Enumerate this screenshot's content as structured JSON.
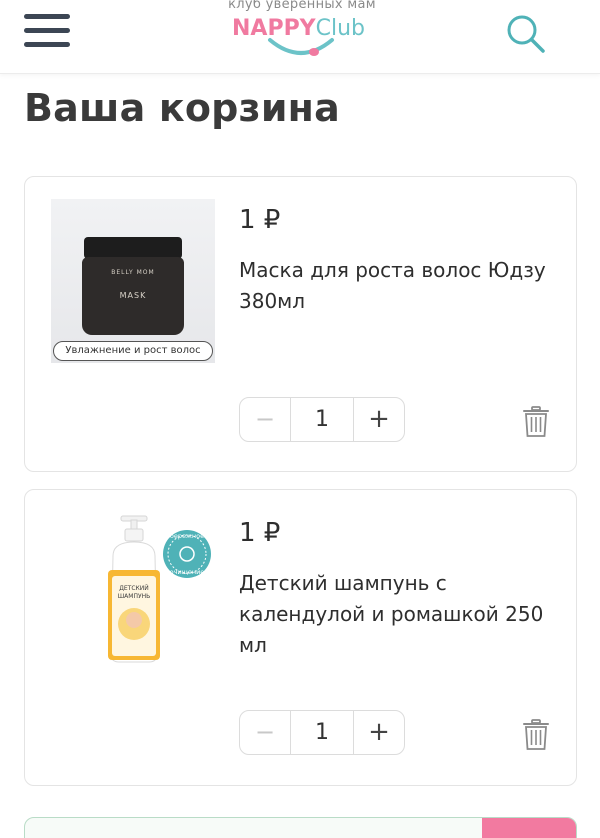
{
  "header": {
    "tagline": "клуб уверенных мам",
    "brand_part1": "NAPPY",
    "brand_part2": "Club",
    "brand_color_pink": "#f07aa0",
    "brand_color_teal": "#6cc3c8",
    "menu_icon": "hamburger-menu-icon",
    "search_icon": "search-icon"
  },
  "page": {
    "title": "Ваша корзина"
  },
  "cart": {
    "items": [
      {
        "price": "1 ₽",
        "name": "Маска для роста волос Юдзу 380мл",
        "image_badge": "Увлажнение и рост волос",
        "jar_brand": "BELLY MOM",
        "jar_label": "MASK",
        "quantity": "1",
        "minus_label": "−",
        "plus_label": "+",
        "delete_icon": "trash-icon"
      },
      {
        "price": "1 ₽",
        "name": "Детский шампунь с календулой и ромашкой 250 мл",
        "sticker_line1": "бережное",
        "sticker_line2": "очищение",
        "bottle_label_line1": "ДЕТСКИЙ",
        "bottle_label_line2": "ШАМПУНЬ",
        "quantity": "1",
        "minus_label": "−",
        "plus_label": "+",
        "delete_icon": "trash-icon"
      }
    ]
  },
  "colors": {
    "accent_pink": "#f27aa0",
    "teal": "#5bb8bd",
    "text_dark": "#2e2e2e"
  }
}
